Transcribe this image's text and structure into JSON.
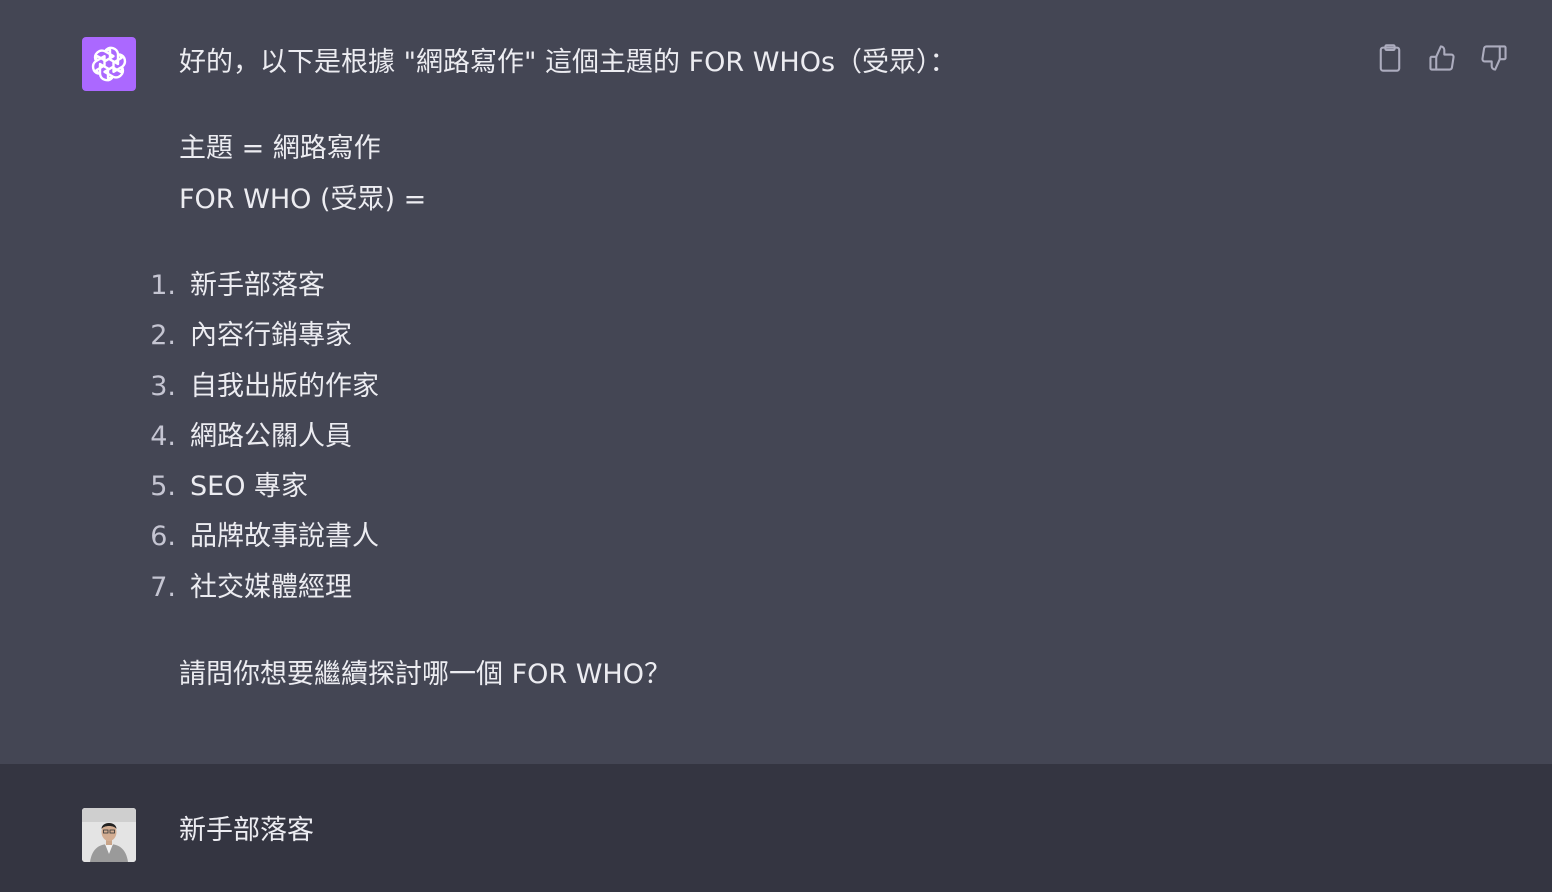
{
  "assistant": {
    "intro": "好的，以下是根據 \"網路寫作\" 這個主題的 FOR WHOs（受眾）：",
    "topic_line": "主題 = 網路寫作",
    "forwho_line": "FOR WHO (受眾) =",
    "items": [
      {
        "num": "1.",
        "label": "新手部落客"
      },
      {
        "num": "2.",
        "label": "內容行銷專家"
      },
      {
        "num": "3.",
        "label": "自我出版的作家"
      },
      {
        "num": "4.",
        "label": "網路公關人員"
      },
      {
        "num": "5.",
        "label": "SEO 專家"
      },
      {
        "num": "6.",
        "label": "品牌故事說書人"
      },
      {
        "num": "7.",
        "label": "社交媒體經理"
      }
    ],
    "question": "請問你想要繼續探討哪一個 FOR WHO？",
    "avatar_icon": "openai-logo-icon",
    "avatar_color": "#ab68ff",
    "actions": [
      "clipboard-icon",
      "thumbs-up-icon",
      "thumbs-down-icon"
    ]
  },
  "user": {
    "message": "新手部落客",
    "avatar_icon": "user-photo"
  },
  "colors": {
    "assistant_bg": "#444654",
    "user_bg": "#343541",
    "text": "#ececf1"
  }
}
